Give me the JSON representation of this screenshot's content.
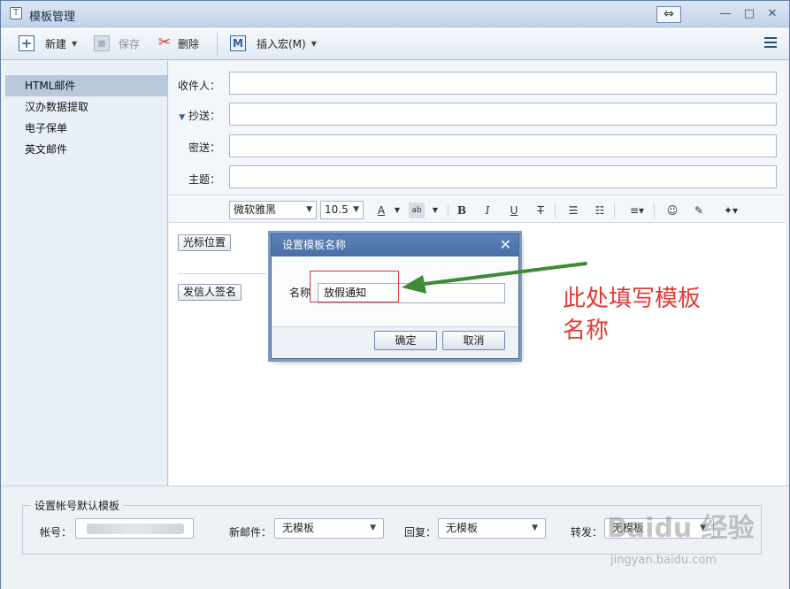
{
  "window": {
    "title": "模板管理",
    "resize_glyph": "⇔",
    "minimize_glyph": "—",
    "maximize_glyph": "□",
    "close_glyph": "✕"
  },
  "toolbar": {
    "new_label": "新建",
    "save_label": "保存",
    "delete_label": "删除",
    "insert_macro_label": "插入宏(M)"
  },
  "templates": [
    "HTML邮件",
    "汉办数据提取",
    "电子保单",
    "英文邮件"
  ],
  "selected_template": "HTML邮件",
  "form": {
    "to_label": "收件人：",
    "cc_label": "抄送：",
    "bcc_label": "密送：",
    "subject_label": "主题："
  },
  "format_bar": {
    "font": "微软雅黑",
    "size": "10.5"
  },
  "editor": {
    "cursor_macro": "光标位置",
    "signature_macro": "发信人签名"
  },
  "dialog": {
    "title": "设置模板名称",
    "name_label": "名称",
    "name_value": "放假通知",
    "ok_label": "确定",
    "cancel_label": "取消"
  },
  "annotation": {
    "line1": "此处填写模板",
    "line2": "名称",
    "color": "#e23a35"
  },
  "defaults": {
    "group_title": "设置帐号默认模板",
    "account_label": "帐号：",
    "new_mail_label": "新邮件：",
    "new_mail_value": "无模板",
    "reply_label": "回复：",
    "reply_value": "无模板",
    "forward_label": "转发：",
    "forward_value": "无模板"
  },
  "watermark": {
    "text": "Baidu 经验",
    "sub": "jingyan.baidu.com"
  }
}
